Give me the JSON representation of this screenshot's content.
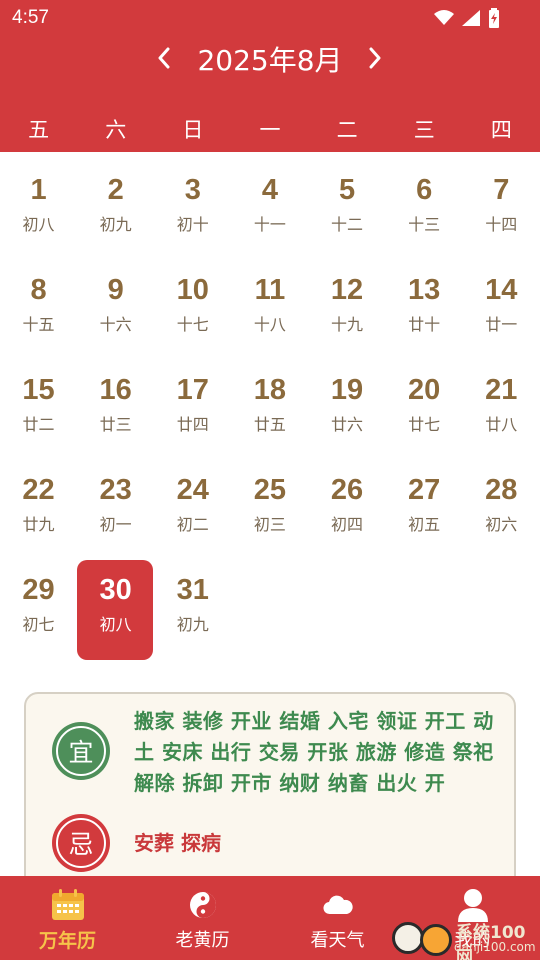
{
  "status_bar": {
    "time": "4:57"
  },
  "header": {
    "month_title": "2025年8月",
    "prev_icon": "chevron-left-icon",
    "next_icon": "chevron-right-icon"
  },
  "weekdays": [
    "五",
    "六",
    "日",
    "一",
    "二",
    "三",
    "四"
  ],
  "calendar": {
    "selected_day": "30",
    "weeks": [
      [
        {
          "d": "1",
          "l": "初八"
        },
        {
          "d": "2",
          "l": "初九"
        },
        {
          "d": "3",
          "l": "初十"
        },
        {
          "d": "4",
          "l": "十一"
        },
        {
          "d": "5",
          "l": "十二"
        },
        {
          "d": "6",
          "l": "十三"
        },
        {
          "d": "7",
          "l": "十四"
        }
      ],
      [
        {
          "d": "8",
          "l": "十五"
        },
        {
          "d": "9",
          "l": "十六"
        },
        {
          "d": "10",
          "l": "十七"
        },
        {
          "d": "11",
          "l": "十八"
        },
        {
          "d": "12",
          "l": "十九"
        },
        {
          "d": "13",
          "l": "廿十"
        },
        {
          "d": "14",
          "l": "廿一"
        }
      ],
      [
        {
          "d": "15",
          "l": "廿二"
        },
        {
          "d": "16",
          "l": "廿三"
        },
        {
          "d": "17",
          "l": "廿四"
        },
        {
          "d": "18",
          "l": "廿五"
        },
        {
          "d": "19",
          "l": "廿六"
        },
        {
          "d": "20",
          "l": "廿七"
        },
        {
          "d": "21",
          "l": "廿八"
        }
      ],
      [
        {
          "d": "22",
          "l": "廿九"
        },
        {
          "d": "23",
          "l": "初一"
        },
        {
          "d": "24",
          "l": "初二"
        },
        {
          "d": "25",
          "l": "初三"
        },
        {
          "d": "26",
          "l": "初四"
        },
        {
          "d": "27",
          "l": "初五"
        },
        {
          "d": "28",
          "l": "初六"
        }
      ],
      [
        {
          "d": "29",
          "l": "初七"
        },
        {
          "d": "30",
          "l": "初八"
        },
        {
          "d": "31",
          "l": "初九"
        }
      ]
    ]
  },
  "almanac": {
    "yi_label": "宜",
    "yi_text": "搬家 装修 开业 结婚 入宅 领证 开工 动土 安床 出行 交易 开张 旅游 修造 祭祀 解除 拆卸 开市 纳财 纳畜 出火 开",
    "ji_label": "忌",
    "ji_text": "安葬 探病"
  },
  "tabs": [
    {
      "label": "万年历",
      "icon": "calendar-icon",
      "active": true
    },
    {
      "label": "老黄历",
      "icon": "yin-yang-icon",
      "active": false
    },
    {
      "label": "看天气",
      "icon": "cloud-icon",
      "active": false
    },
    {
      "label": "我的",
      "icon": "user-icon",
      "active": false
    }
  ],
  "watermark": {
    "line1": "系统100网",
    "line2": "danji100.com"
  },
  "colors": {
    "primary_red": "#d23a3d",
    "gold_number": "#8b6a3c",
    "yi_green": "#4e8f5a",
    "active_tab": "#f6c34a"
  }
}
